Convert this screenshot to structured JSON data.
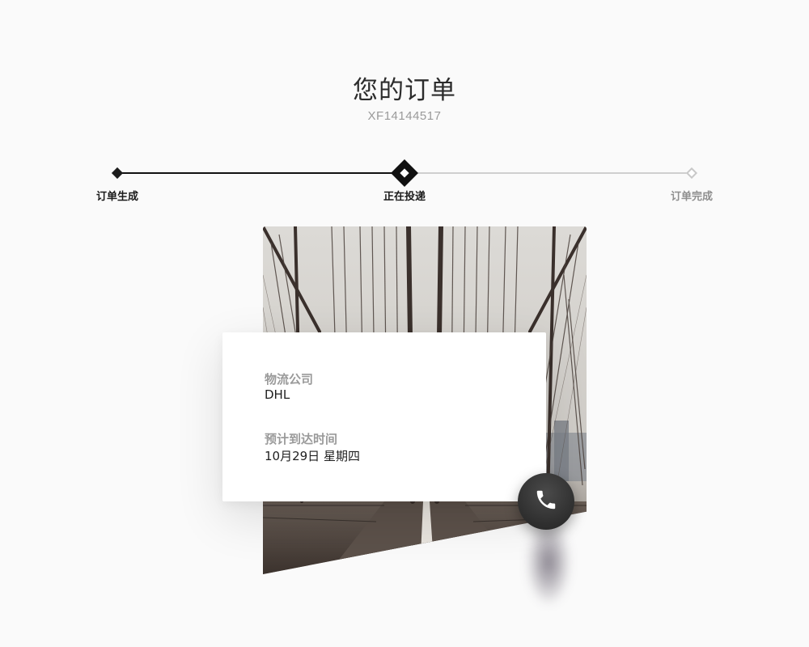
{
  "header": {
    "title": "您的订单",
    "order_id": "XF14144517"
  },
  "progress": {
    "steps": [
      {
        "label": "订单生成",
        "state": "done"
      },
      {
        "label": "正在投递",
        "state": "current"
      },
      {
        "label": "订单完成",
        "state": "pending"
      }
    ]
  },
  "shipment": {
    "carrier_label": "物流公司",
    "carrier_value": "DHL",
    "eta_label": "预计到达时间",
    "eta_value": "10月29日 星期四"
  },
  "icons": {
    "call": "phone-icon",
    "progress_nodes": "diamond-icon"
  },
  "colors": {
    "background": "#fafafa",
    "accent": "#111111",
    "muted": "#9a9a9a",
    "card": "#ffffff",
    "call_button": "#333333"
  }
}
